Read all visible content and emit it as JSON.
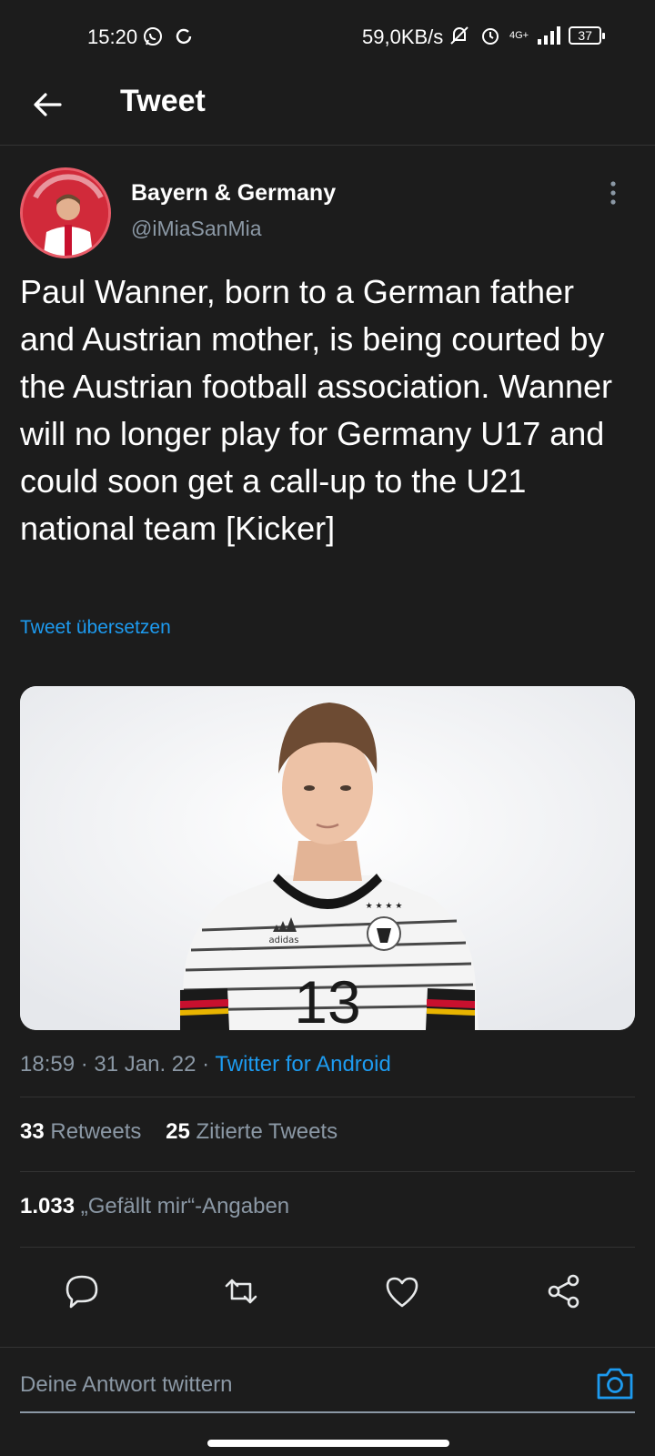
{
  "status_bar": {
    "time": "15:20",
    "network_speed": "59,0KB/s",
    "network_type": "4G+",
    "battery": "37"
  },
  "header": {
    "title": "Tweet"
  },
  "tweet": {
    "author_name": "Bayern & Germany",
    "author_handle": "@iMiaSanMia",
    "text": "Paul Wanner, born to a German father and Austrian mother, is being courted by the Austrian football association. Wanner will no longer play for Germany U17 and could soon get a call-up to the U21 national team [Kicker]",
    "translate_label": "Tweet übersetzen",
    "time": "18:59",
    "date": "31 Jan. 22",
    "separator": "·",
    "source": "Twitter for Android",
    "media": {
      "jersey_number": "13",
      "brand_text": "adidas"
    }
  },
  "stats": {
    "retweets_count": "33",
    "retweets_label": "Retweets",
    "quotes_count": "25",
    "quotes_label": "Zitierte Tweets",
    "likes_count": "1.033",
    "likes_label": "„Gefällt mir“-Angaben"
  },
  "reply": {
    "placeholder": "Deine Antwort twittern"
  },
  "colors": {
    "background": "#1c1c1c",
    "link": "#1d9bf0",
    "muted": "#8b98a5",
    "text": "#ffffff"
  },
  "icons": {
    "back": "arrow-left-icon",
    "more": "more-vertical-icon",
    "reply": "comment-icon",
    "retweet": "retweet-icon",
    "like": "heart-icon",
    "share": "share-icon",
    "camera": "camera-icon"
  }
}
